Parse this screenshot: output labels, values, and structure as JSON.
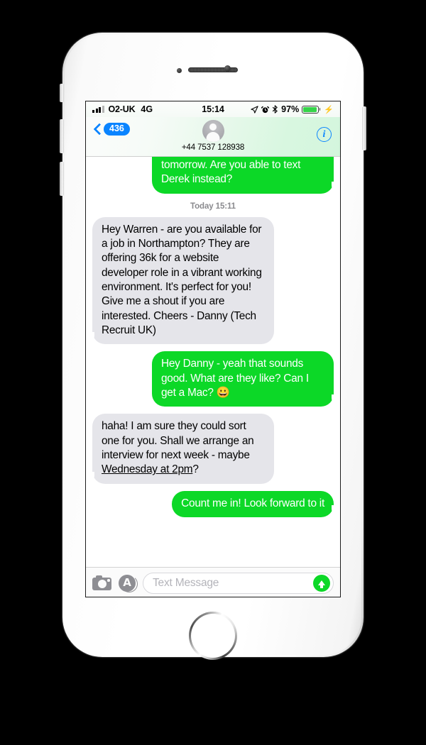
{
  "status_bar": {
    "carrier": "O2-UK",
    "network": "4G",
    "time": "15:14",
    "battery_percent": "97%",
    "icons": [
      "signal-bars-icon",
      "location-arrow-icon",
      "alarm-clock-icon",
      "bluetooth-icon",
      "battery-icon",
      "charging-bolt-icon"
    ]
  },
  "nav_bar": {
    "back_badge": "436",
    "contact_name": "+44 7537 128938",
    "info_label": "i"
  },
  "conversation": {
    "timestamp": "Today 15:11",
    "messages": [
      {
        "id": "m1",
        "direction": "out",
        "clipped": true,
        "text": "tomorrow. Are you able to text Derek instead?"
      },
      {
        "id": "m2",
        "direction": "in",
        "clipped": false,
        "text": "Hey Warren - are you available for a job in Northampton? They are offering 36k for a website developer role in a vibrant working environment. It's perfect for you! Give me a shout if you are interested. Cheers - Danny (Tech Recruit UK)"
      },
      {
        "id": "m3",
        "direction": "out",
        "clipped": false,
        "text_before": "Hey Danny - yeah that sounds good. What are they like? Can I get a Mac? ",
        "emoji": "😀"
      },
      {
        "id": "m4",
        "direction": "in",
        "clipped": false,
        "text_before": "haha! I am sure they could sort one for you. Shall we arrange an interview for next week - maybe ",
        "link_text": "Wednesday at 2pm",
        "text_after": "?"
      },
      {
        "id": "m5",
        "direction": "out",
        "clipped": false,
        "text": "Count me in! Look forward to it"
      }
    ]
  },
  "toolbar": {
    "camera_icon": "camera-icon",
    "appstore_icon": "app-store-icon",
    "appstore_glyph": "A",
    "placeholder": "Text Message",
    "send_icon": "send-arrow-icon"
  },
  "colors": {
    "sent_bubble": "#0CD827",
    "received_bubble": "#E5E5EA",
    "accent_blue": "#0A84FF",
    "battery_green": "#35D449"
  }
}
